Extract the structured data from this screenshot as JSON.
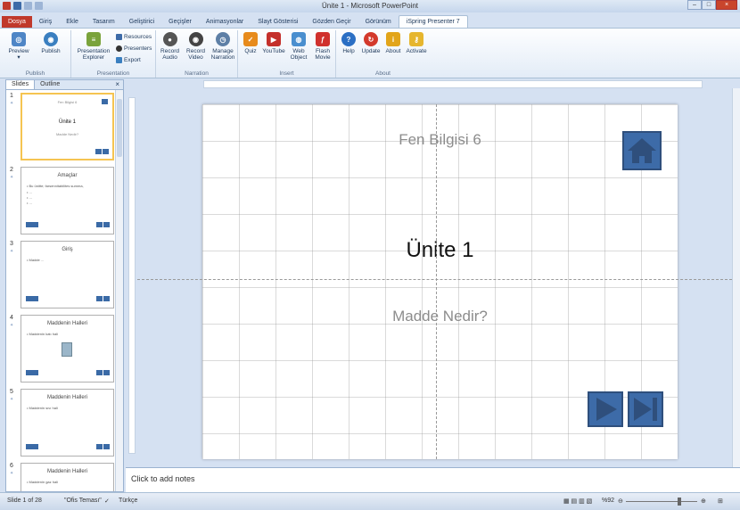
{
  "window": {
    "title": "Ünite 1 - Microsoft PowerPoint"
  },
  "tabs": [
    "Dosya",
    "Giriş",
    "Ekle",
    "Tasarım",
    "Geliştirici",
    "Geçişler",
    "Animasyonlar",
    "Slayt Gösterisi",
    "Gözden Geçir",
    "Görünüm",
    "iSpring Presenter 7"
  ],
  "ribbon": {
    "publish": {
      "label": "Publish",
      "buttons": [
        "Preview",
        "Publish"
      ]
    },
    "presentation": {
      "label": "Presentation",
      "explorer": "Presentation Explorer",
      "resources": "Resources",
      "presenters": "Presenters",
      "export": "Export"
    },
    "narration": {
      "label": "Narration",
      "buttons": [
        "Record Audio",
        "Record Video",
        "Manage Narration"
      ]
    },
    "insert": {
      "label": "Insert",
      "buttons": [
        "Quiz",
        "YouTube",
        "Web Object",
        "Flash Movie"
      ]
    },
    "about": {
      "label": "About",
      "buttons": [
        "Help",
        "Update",
        "About",
        "Activate"
      ]
    }
  },
  "pane": {
    "tabs": [
      "Slides",
      "Outline"
    ],
    "close": "×",
    "thumbs": [
      {
        "num": "1",
        "lines": [
          "Fen Bilgisi 6",
          "Ünite 1",
          "Madde Nedir?"
        ]
      },
      {
        "num": "2",
        "lines": [
          "Amaçlar",
          "• Bu ünitte; farsennitabilites summa,",
          "• ...",
          "• ...",
          "• ..."
        ]
      },
      {
        "num": "3",
        "lines": [
          "Giriş",
          "• Madde ..."
        ]
      },
      {
        "num": "4",
        "lines": [
          "Maddenin Halleri",
          "• Maddenin katı hali"
        ]
      },
      {
        "num": "5",
        "lines": [
          "Maddenin Halleri",
          "• Maddenin sıvı hali"
        ]
      },
      {
        "num": "6",
        "lines": [
          "Maddenin Halleri",
          "• Maddenin gaz hali"
        ]
      }
    ]
  },
  "slide": {
    "title": "Fen Bilgisi 6",
    "main": "Ünite 1",
    "subtitle": "Madde Nedir?"
  },
  "notes": {
    "placeholder": "Click to add notes"
  },
  "status": {
    "slide": "Slide 1 of 28",
    "theme": "\"Ofis Teması\"",
    "language": "Türkçe",
    "zoom": "%92"
  }
}
